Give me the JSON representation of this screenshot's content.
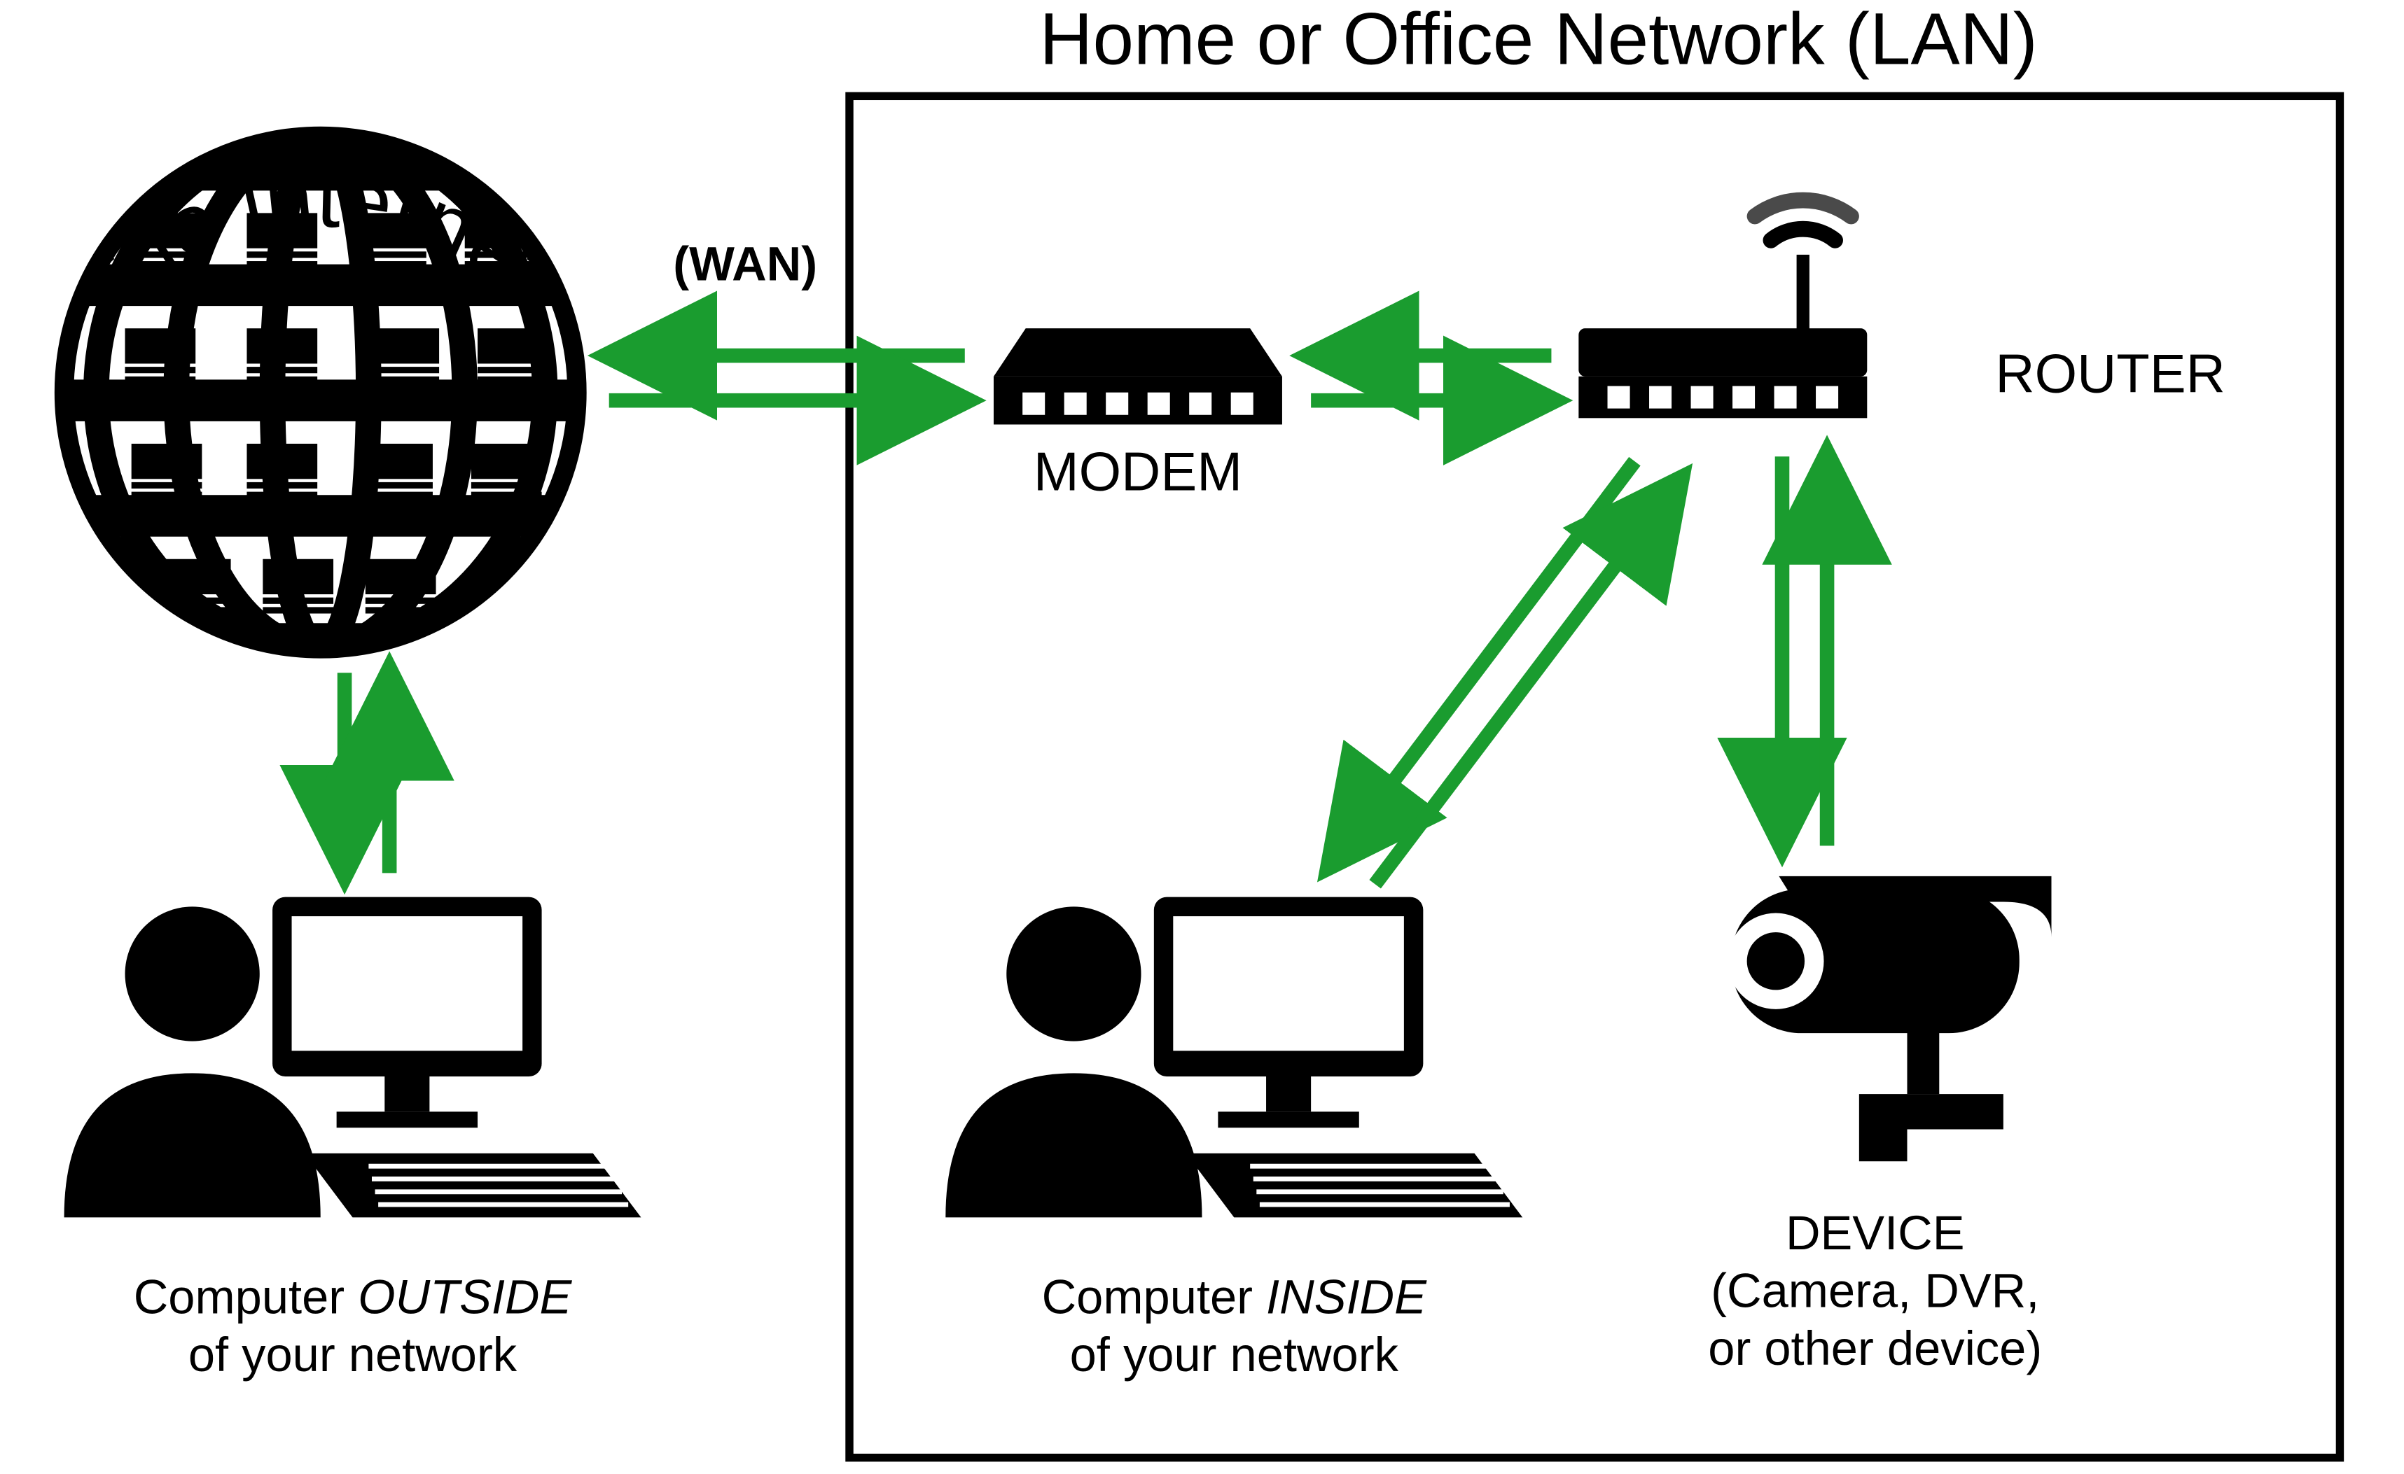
{
  "title": "Home or Office Network (LAN)",
  "internet_label": "the internet",
  "wan_label": "(WAN)",
  "modem_label": "MODEM",
  "router_label": "ROUTER",
  "outside_label_1": "Computer ",
  "outside_label_em": "OUTSIDE",
  "outside_label_2": "of your network",
  "inside_label_1": "Computer ",
  "inside_label_em": "INSIDE",
  "inside_label_2": "of your network",
  "device_label_1": "DEVICE",
  "device_label_2": "(Camera, DVR,",
  "device_label_3": "or other device)",
  "arrow_color": "#1a9c2f",
  "connections": [
    {
      "from": "internet",
      "to": "modem",
      "bidir": true
    },
    {
      "from": "modem",
      "to": "router",
      "bidir": true
    },
    {
      "from": "internet",
      "to": "computer_outside",
      "bidir": true
    },
    {
      "from": "router",
      "to": "computer_inside",
      "bidir": true
    },
    {
      "from": "router",
      "to": "device",
      "bidir": true
    }
  ],
  "nodes": [
    {
      "id": "internet",
      "label": "the internet"
    },
    {
      "id": "modem",
      "label": "MODEM"
    },
    {
      "id": "router",
      "label": "ROUTER"
    },
    {
      "id": "computer_outside",
      "label": "Computer OUTSIDE of your network"
    },
    {
      "id": "computer_inside",
      "label": "Computer INSIDE of your network"
    },
    {
      "id": "device",
      "label": "DEVICE (Camera, DVR, or other device)"
    }
  ]
}
